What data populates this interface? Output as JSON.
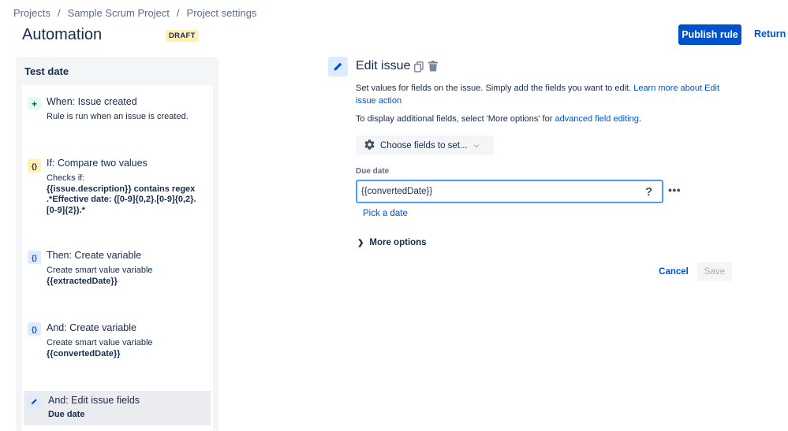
{
  "breadcrumb": [
    "Projects",
    "Sample Scrum Project",
    "Project settings"
  ],
  "header": {
    "title": "Automation",
    "status_badge": "DRAFT",
    "publish_label": "Publish rule",
    "return_label": "Return to"
  },
  "rule": {
    "name": "Test date",
    "steps": [
      {
        "type": "trigger",
        "icon": "plus-icon",
        "title": "When: Issue created",
        "desc": "Rule is run when an issue is created."
      },
      {
        "type": "condition",
        "icon": "braces-icon",
        "title": "If: Compare two values",
        "desc": "Checks if:",
        "detail": "{{issue.description}} contains regex .*Effective date: ([0-9]{0,2}.[0-9]{0,2}.[0-9]{2}).*"
      },
      {
        "type": "action",
        "icon": "braces-icon",
        "title": "Then: Create variable",
        "desc": "Create smart value variable",
        "detail": "{{extractedDate}}"
      },
      {
        "type": "action",
        "icon": "braces-icon",
        "title": "And: Create variable",
        "desc": "Create smart value variable",
        "detail": "{{convertedDate}}"
      },
      {
        "type": "action",
        "icon": "pencil-icon",
        "title": "And: Edit issue fields",
        "detail": "Due date",
        "selected": true
      }
    ]
  },
  "editor": {
    "title": "Edit issue",
    "description": "Set values for fields on the issue. Simply add the fields you want to edit.",
    "learn_more_link": "Learn more about Edit issue action",
    "additional_text": "To display additional fields, select 'More options' for",
    "advanced_link": "advanced field editing",
    "choose_fields_label": "Choose fields to set...",
    "field_label": "Due date",
    "field_value": "{{convertedDate}}",
    "pick_date_label": "Pick a date",
    "more_options_label": "More options",
    "cancel_label": "Cancel",
    "save_label": "Save"
  },
  "colors": {
    "primary": "#0052CC",
    "text": "#172B4D",
    "subtle": "#5E6C84",
    "draft_badge": "#FFF0B3",
    "trigger_icon_bg": "#E3FCEF",
    "condition_icon_bg": "#FFF0B3",
    "action_icon_bg": "#DEEBFF",
    "focus_border": "#4C9AFF"
  }
}
